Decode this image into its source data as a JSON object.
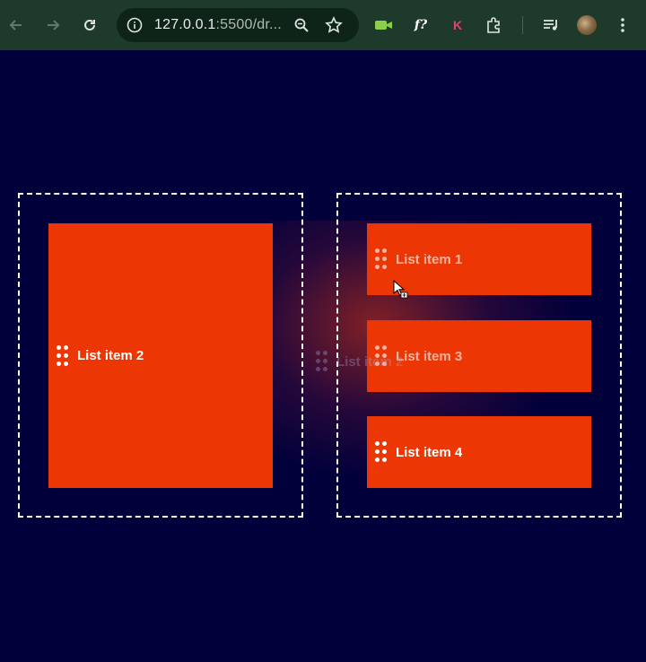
{
  "browser": {
    "url_host": "127.0.0.1",
    "url_path": ":5500/dr...",
    "icons": [
      "back-arrow-icon",
      "forward-arrow-icon",
      "reload-icon",
      "site-info-icon",
      "zoom-icon",
      "bookmark-star-icon",
      "video-camera-icon",
      "font-extension-icon",
      "k-extension-icon",
      "extensions-puzzle-icon",
      "media-queue-icon",
      "profile-avatar",
      "kebab-menu-icon"
    ],
    "ext_f_label": "f?",
    "ext_k_label": "K"
  },
  "colors": {
    "page_bg": "#02003a",
    "card": "#ec3603",
    "toolbar": "#1d3a2b"
  },
  "left_zone": {
    "items": [
      {
        "label": "List item 2"
      }
    ]
  },
  "right_zone": {
    "items": [
      {
        "label": "List item 1"
      },
      {
        "label": "List item 3"
      },
      {
        "label": "List item 4"
      }
    ]
  },
  "drag_ghost": {
    "label": "List item 2"
  }
}
